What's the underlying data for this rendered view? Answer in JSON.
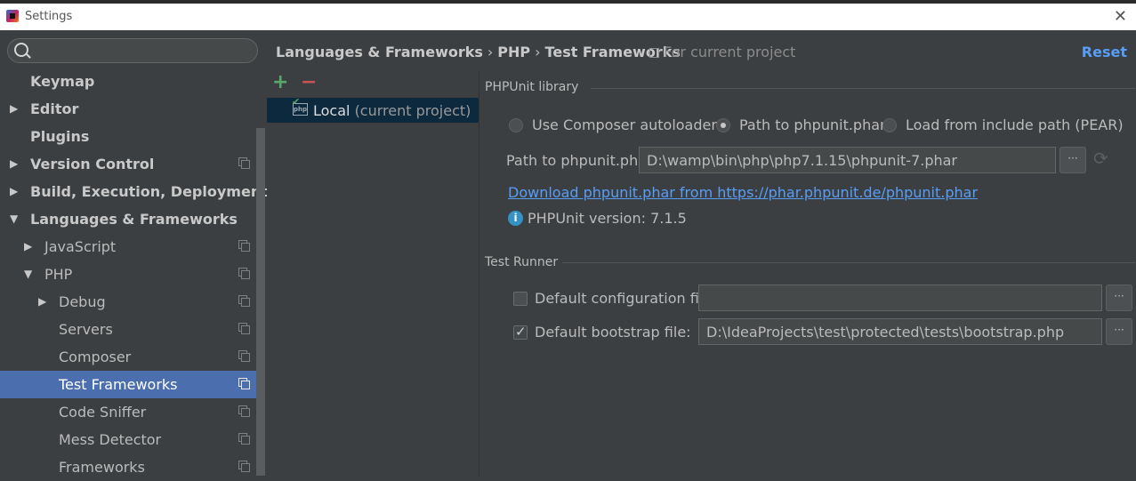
{
  "window": {
    "title": "Settings"
  },
  "sidebar": {
    "search_placeholder": "",
    "items": [
      {
        "label": "Keymap",
        "level": 0,
        "arrow": "",
        "bold": true,
        "project": false
      },
      {
        "label": "Editor",
        "level": 0,
        "arrow": "▶",
        "bold": true,
        "project": false
      },
      {
        "label": "Plugins",
        "level": 0,
        "arrow": "",
        "bold": true,
        "project": false
      },
      {
        "label": "Version Control",
        "level": 0,
        "arrow": "▶",
        "bold": true,
        "project": true
      },
      {
        "label": "Build, Execution, Deployment",
        "level": 0,
        "arrow": "▶",
        "bold": true,
        "project": false
      },
      {
        "label": "Languages & Frameworks",
        "level": 0,
        "arrow": "▼",
        "bold": true,
        "project": false
      },
      {
        "label": "JavaScript",
        "level": 1,
        "arrow": "▶",
        "bold": false,
        "project": true
      },
      {
        "label": "PHP",
        "level": 1,
        "arrow": "▼",
        "bold": false,
        "project": true
      },
      {
        "label": "Debug",
        "level": 2,
        "arrow": "▶",
        "bold": false,
        "project": true
      },
      {
        "label": "Servers",
        "level": 2,
        "arrow": "",
        "bold": false,
        "project": true
      },
      {
        "label": "Composer",
        "level": 2,
        "arrow": "",
        "bold": false,
        "project": true
      },
      {
        "label": "Test Frameworks",
        "level": 2,
        "arrow": "",
        "bold": false,
        "project": true,
        "selected": true
      },
      {
        "label": "Code Sniffer",
        "level": 2,
        "arrow": "",
        "bold": false,
        "project": true
      },
      {
        "label": "Mess Detector",
        "level": 2,
        "arrow": "",
        "bold": false,
        "project": true
      },
      {
        "label": "Frameworks",
        "level": 2,
        "arrow": "",
        "bold": false,
        "project": true
      }
    ]
  },
  "header": {
    "crumbs": [
      "Languages & Frameworks",
      "PHP",
      "Test Frameworks"
    ],
    "separator": "›",
    "scope": "For current project",
    "reset": "Reset"
  },
  "config_list": {
    "add_icon": "+",
    "remove_icon": "−",
    "items": [
      {
        "name": "Local",
        "detail": "(current project)",
        "icon_text": "php"
      }
    ]
  },
  "phpunit": {
    "section_title": "PHPUnit library",
    "radios": [
      {
        "label": "Use Composer autoloader",
        "checked": false
      },
      {
        "label": "Path to phpunit.phar",
        "checked": true
      },
      {
        "label": "Load from include path (PEAR)",
        "checked": false
      }
    ],
    "path_label": "Path to phpunit.phar",
    "path_value": "D:\\wamp\\bin\\php\\php7.1.15\\phpunit-7.phar",
    "browse": "···",
    "download_link": "Download phpunit.phar from https://phar.phpunit.de/phpunit.phar",
    "info_icon": "i",
    "version_text": "PHPUnit version: 7.1.5"
  },
  "runner": {
    "section_title": "Test Runner",
    "config_label": "Default configuration file:",
    "config_checked": false,
    "config_value": "",
    "bootstrap_label": "Default bootstrap file:",
    "bootstrap_checked": true,
    "bootstrap_value": "D:\\IdeaProjects\\test\\protected\\tests\\bootstrap.php",
    "browse": "···"
  },
  "colors": {
    "accent": "#589df6",
    "selection": "#4b6eaf",
    "background": "#3c3f41"
  }
}
